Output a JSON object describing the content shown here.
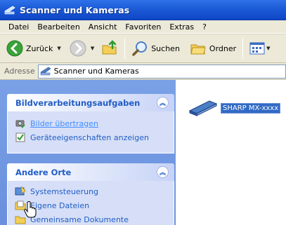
{
  "window": {
    "title": "Scanner und Kameras"
  },
  "menu": [
    "Datei",
    "Bearbeiten",
    "Ansicht",
    "Favoriten",
    "Extras",
    "?"
  ],
  "toolbar": {
    "back_label": "Zurück",
    "search_label": "Suchen",
    "folders_label": "Ordner"
  },
  "address": {
    "label": "Adresse",
    "value": "Scanner und Kameras"
  },
  "panels": {
    "image_tasks": {
      "title": "Bildverarbeitungsaufgaben",
      "items": [
        "Bilder übertragen",
        "Geräteeigenschaften anzeigen"
      ]
    },
    "other_places": {
      "title": "Andere Orte",
      "items": [
        "Systemsteuerung",
        "Eigene Dateien",
        "Gemeinsame Dokumente"
      ]
    }
  },
  "devices": [
    {
      "label": "SHARP MX-xxxx"
    }
  ],
  "colors": {
    "titlebar": "#0e46c7",
    "taskpane": "#6a90de",
    "link": "#215dc6",
    "selection": "#316ac5"
  }
}
